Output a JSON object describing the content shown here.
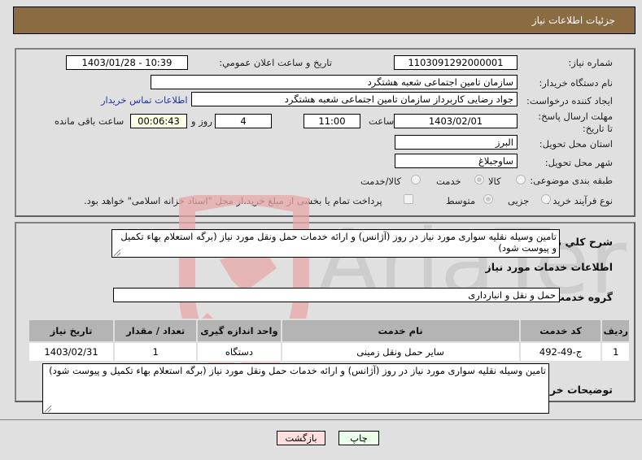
{
  "header": {
    "title": "جزئیات اطلاعات نیاز"
  },
  "form": {
    "need_number": {
      "label": "شماره نیاز:",
      "value": "1103091292000001"
    },
    "announce_datetime": {
      "label": "تاریخ و ساعت اعلان عمومي:",
      "value": "1403/01/28 - 10:39"
    },
    "buyer_org": {
      "label": "نام دستگاه خریدار:",
      "value": "سازمان تامین اجتماعی شعبه هشتگرد"
    },
    "requester": {
      "label": "ایجاد کننده درخواست:",
      "value": "جواد رضایی کاربرداز سازمان تامین اجتماعی شعبه هشتگرد",
      "contact_link": "اطلاعات تماس خریدار"
    },
    "deadline": {
      "label": "مهلت ارسال پاسخ: تا تاریخ:",
      "date": "1403/02/01",
      "time_label": "ساعت",
      "time": "11:00",
      "days": "4",
      "days_label": "روز و",
      "remaining": "00:06:43",
      "remaining_label": "ساعت باقی مانده"
    },
    "province": {
      "label": "استان محل تحویل:",
      "value": "البرز"
    },
    "city": {
      "label": "شهر محل تحویل:",
      "value": "ساوجبلاغ"
    },
    "category": {
      "label": "طبقه بندی موضوعی:",
      "options": [
        {
          "label": "کالا",
          "selected": false
        },
        {
          "label": "خدمت",
          "selected": true
        },
        {
          "label": "کالا/خدمت",
          "selected": false
        }
      ]
    },
    "purchase_type": {
      "label": "نوع فرآیند خرید :",
      "options": [
        {
          "label": "جزیی",
          "selected": false
        },
        {
          "label": "متوسط",
          "selected": true
        }
      ],
      "payment_checkbox": {
        "checked": false,
        "label": "پرداخت تمام یا بخشی از مبلغ خرید،از محل \"اسناد خزانه اسلامی\" خواهد بود."
      }
    }
  },
  "details": {
    "summary_label": "شرح كلي نياز:",
    "summary": "تامین وسیله نقلیه سواری مورد نیاز در روز (آژانس) و ارائه خدمات حمل ونقل مورد نیاز (برگه استعلام بهاء تکمیل و پیوست شود)",
    "services_title": "اطلاعات خدمات مورد نیاز",
    "service_group_label": "گروه خدمت:",
    "service_group": "حمل و نقل و انبارداری",
    "table": {
      "headers": [
        "ردیف",
        "کد خدمت",
        "نام خدمت",
        "واحد اندازه گیری",
        "تعداد / مقدار",
        "تاریخ نیاز"
      ],
      "rows": [
        [
          "1",
          "ج-49-492",
          "سایر حمل ونقل زمینی",
          "دستگاه",
          "1",
          "1403/02/31"
        ]
      ]
    },
    "buyer_notes_label": "توضیحات خریدار:",
    "buyer_notes": "تامین وسیله نقلیه سواری مورد نیاز در روز (آژانس) و ارائه خدمات حمل ونقل مورد نیاز (برگه استعلام بهاء تکمیل و پیوست شود)"
  },
  "buttons": {
    "print": "چاپ",
    "back": "بازگشت"
  },
  "watermark": {
    "text": "AriaTender.neT"
  }
}
